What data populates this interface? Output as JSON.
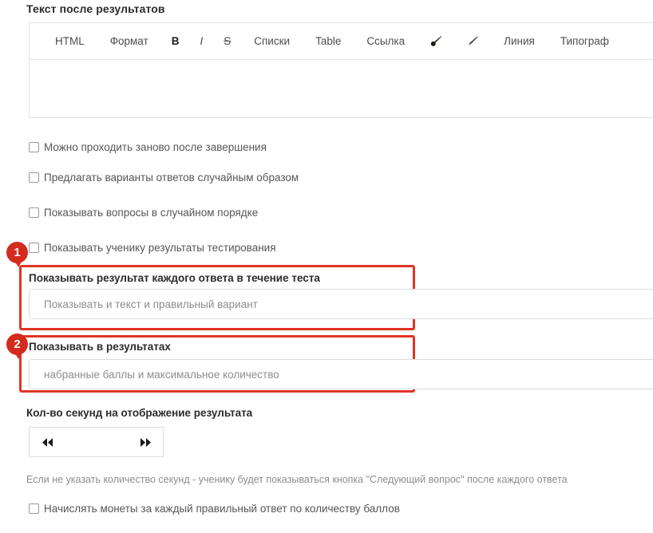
{
  "section": {
    "title": "Текст после результатов"
  },
  "editor": {
    "toolbar": [
      {
        "label": "HTML",
        "name": "toolbar-html",
        "kind": "text"
      },
      {
        "label": "Формат",
        "name": "toolbar-format",
        "kind": "text"
      },
      {
        "label": "B",
        "name": "toolbar-bold",
        "kind": "bold"
      },
      {
        "label": "I",
        "name": "toolbar-italic",
        "kind": "italic"
      },
      {
        "label": "S",
        "name": "toolbar-strikethrough",
        "kind": "strike"
      },
      {
        "label": "Списки",
        "name": "toolbar-lists",
        "kind": "text"
      },
      {
        "label": "Table",
        "name": "toolbar-table",
        "kind": "text"
      },
      {
        "label": "Ссылка",
        "name": "toolbar-link",
        "kind": "text"
      },
      {
        "label": "",
        "name": "paintbrush-icon",
        "kind": "icon-brush"
      },
      {
        "label": "",
        "name": "pencil-icon",
        "kind": "icon-pencil"
      },
      {
        "label": "Линия",
        "name": "toolbar-line",
        "kind": "text"
      },
      {
        "label": "Типограф",
        "name": "toolbar-typograph",
        "kind": "text"
      }
    ],
    "content": ""
  },
  "checkboxes": [
    {
      "label": "Можно проходить заново после завершения",
      "name": "checkbox-retake",
      "checked": false
    },
    {
      "label": "Предлагать варианты ответов случайным образом",
      "name": "checkbox-shuffle-answers",
      "checked": false
    },
    {
      "label": "Показывать вопросы в случайном порядке",
      "name": "checkbox-shuffle-questions",
      "checked": false
    },
    {
      "label": "Показывать ученику результаты тестирования",
      "name": "checkbox-show-results",
      "checked": false
    }
  ],
  "field_show_each_answer": {
    "label": "Показывать результат каждого ответа в течение теста",
    "value": "Показывать и текст и правильный вариант",
    "badge": "1"
  },
  "field_show_in_results": {
    "label": "Показывать в результатах",
    "value": "набранные баллы и максимальное количество",
    "badge": "2"
  },
  "seconds": {
    "label": "Кол-во секунд на отображение результата",
    "value": "",
    "placeholder": "",
    "decrement_icon": "◀◀",
    "increment_icon": "▶▶"
  },
  "hint": "Если не указать количество секунд - ученику будет показываться кнопка \"Следующий вопрос\" после каждого ответа",
  "coins_checkbox": {
    "label": "Начислять монеты за каждый правильный ответ по количеству баллов",
    "checked": false
  },
  "colors": {
    "annotation_red": "#e03426",
    "badge_red": "#d32b1e",
    "border_gray": "#dcdcdc",
    "text_dark": "#2b2b2b",
    "text_muted": "#8d8d8d"
  }
}
